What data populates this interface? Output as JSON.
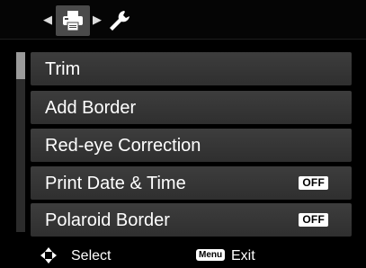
{
  "tabs": {
    "left_arrow": "◀",
    "right_arrow": "▶",
    "items": [
      {
        "icon": "printer-icon",
        "active": true
      },
      {
        "icon": "wrench-icon",
        "active": false
      }
    ]
  },
  "menu": {
    "items": [
      {
        "label": "Trim",
        "value": ""
      },
      {
        "label": "Add Border",
        "value": ""
      },
      {
        "label": "Red-eye Correction",
        "value": ""
      },
      {
        "label": "Print Date & Time",
        "value": "OFF"
      },
      {
        "label": "Polaroid Border",
        "value": "OFF"
      }
    ],
    "scroll_position": 0.0
  },
  "footer": {
    "select_label": "Select",
    "menu_key": "Menu",
    "exit_label": "Exit"
  },
  "colors": {
    "background": "#000000",
    "item_background": "#363636",
    "active_tab": "#4a4a4a",
    "text": "#ffffff"
  }
}
